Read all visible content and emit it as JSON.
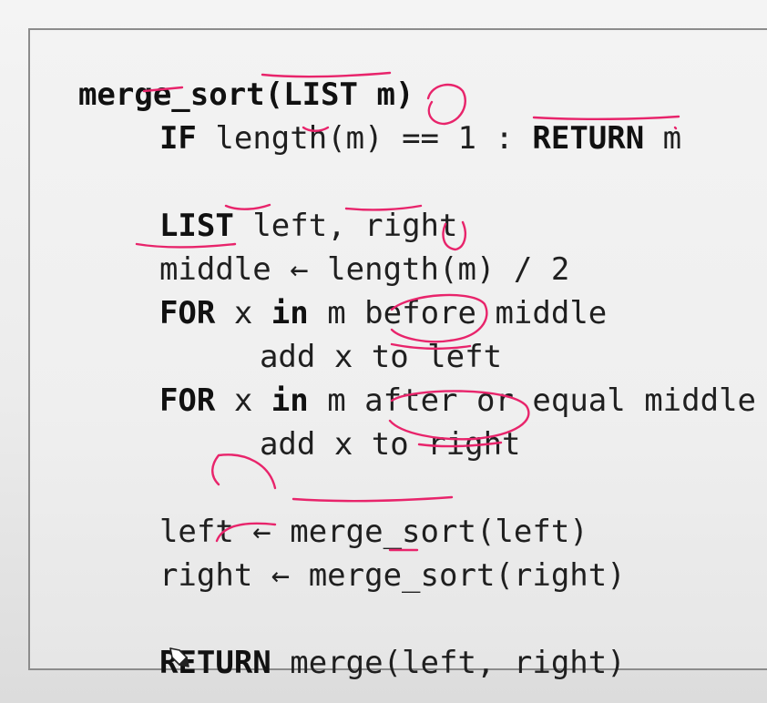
{
  "code": {
    "line1": {
      "fn": "merge_sort(LIST m)"
    },
    "line2": {
      "kw1": "IF",
      "text1": " length(m) == 1 : ",
      "kw2": "RETURN",
      "text2": " m"
    },
    "line3": {
      "kw": "LIST",
      "text": " left, right"
    },
    "line4": {
      "text": "middle ← length(m) / 2"
    },
    "line5": {
      "kw1": "FOR",
      "text1": " x ",
      "kw2": "in",
      "text2": " m before middle"
    },
    "line6": {
      "text": "add x to left"
    },
    "line7": {
      "kw1": "FOR",
      "text1": " x ",
      "kw2": "in",
      "text2": " m after or equal middle"
    },
    "line8": {
      "text": "add x to right"
    },
    "line9": {
      "text": "left ← merge_sort(left)"
    },
    "line10": {
      "text": "right ← merge_sort(right)"
    },
    "line11": {
      "kw": "RETURN",
      "text": " merge(left, right)"
    }
  },
  "colors": {
    "ink": "#e8246b",
    "text": "#1f1f1f",
    "border": "#8c8c8c"
  },
  "icons": {
    "cursor": "pencil-cursor-icon"
  }
}
